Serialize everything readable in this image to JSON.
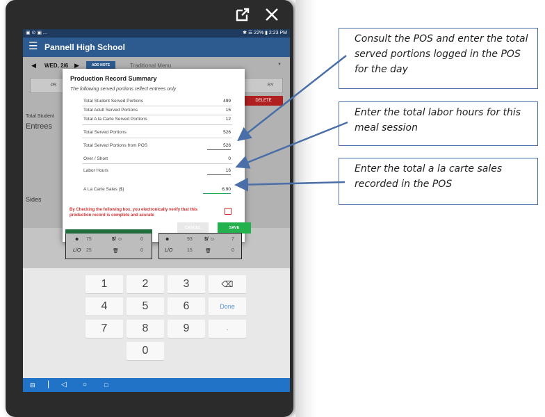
{
  "window": {
    "popout_icon": "popout-icon",
    "close_icon": "close-icon"
  },
  "statusbar": {
    "left": "▣ ⊙ ▣ ...",
    "right": "✱ ☰ 22% ▮ 2:23 PM"
  },
  "app": {
    "title": "Pannell High School",
    "menu_icon": "hamburger-icon"
  },
  "datebar": {
    "prev": "◀",
    "date": "WED, 2/6",
    "next": "▶",
    "add_note": "ADD NOTE",
    "menu_name": "Traditional Menu",
    "caret": "▼"
  },
  "tabs": {
    "left": "PR",
    "right": "RY"
  },
  "delete_label": "DELETE",
  "background": {
    "total_student": "Total Student",
    "entrees": "Entrees",
    "sides": "Sides"
  },
  "dialog": {
    "title": "Production Record Summary",
    "subtitle": "The following served portions reflect entrees only",
    "rows": [
      {
        "label": "Total Student Served Portions",
        "value": "499"
      },
      {
        "label": "Total Adult Served Portions",
        "value": "15"
      },
      {
        "label": "Total A la Carte Served Portions",
        "value": "12"
      }
    ],
    "total_served": {
      "label": "Total Served Portions",
      "value": "526"
    },
    "pos_served": {
      "label": "Total Served Portions from POS",
      "value": "526"
    },
    "over_short": {
      "label": "Over / Short",
      "value": "0"
    },
    "labor_hours": {
      "label": "Labor Hours",
      "value": "16"
    },
    "ala_carte_sales": {
      "label": "A La Carte Sales ($)",
      "value": "6.90"
    },
    "verify_text": "By Checking the following box, you electronically verify that this production record is complete and acurate",
    "cancel": "CANCEL",
    "save": "SAVE"
  },
  "cards": [
    {
      "r1": [
        "75",
        "$/",
        "0"
      ],
      "r2": [
        "L/O",
        "25",
        "0"
      ]
    },
    {
      "r1": [
        "93",
        "$/",
        "7"
      ],
      "r2": [
        "L/O",
        "15",
        "0"
      ]
    }
  ],
  "keypad": {
    "keys": [
      "1",
      "2",
      "3",
      "⌫",
      "4",
      "5",
      "6",
      "Done",
      "7",
      "8",
      "9",
      ".",
      "0"
    ]
  },
  "navbar": {
    "icons": [
      "app-icon",
      "back-icon",
      "home-icon",
      "recents-icon"
    ]
  },
  "callouts": [
    "Consult the POS and enter the total served portions logged in the POS for the day",
    "Enter the total labor hours for this meal session",
    "Enter the total a la carte sales recorded in the POS"
  ],
  "colors": {
    "appbar": "#2e5b8f",
    "save": "#22b14c",
    "delete": "#b02020",
    "verify": "#d32f2f",
    "navbar": "#2073c6"
  }
}
